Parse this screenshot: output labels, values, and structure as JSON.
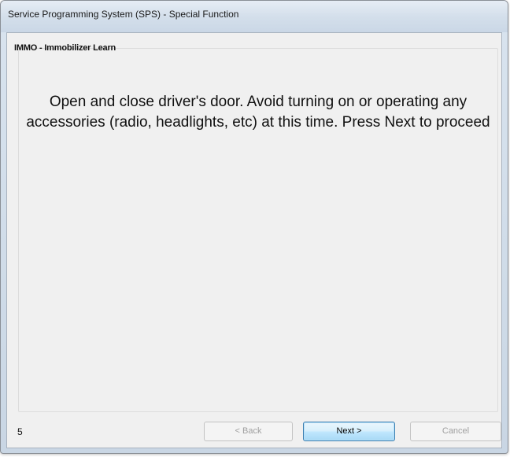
{
  "window": {
    "title": "Service Programming System (SPS) - Special Function"
  },
  "wizard": {
    "header": "IMMO - Immobilizer Learn",
    "instruction": "Open and close driver's door. Avoid turning on or operating any accessories (radio, headlights, etc) at this time. Press Next to proceed",
    "step_number": "5"
  },
  "buttons": {
    "back_label": "< Back",
    "back_enabled": false,
    "next_label": "Next >",
    "next_enabled": true,
    "cancel_label": "Cancel",
    "cancel_enabled": false
  },
  "colors": {
    "titlebar": "#d4dfeb",
    "client_background": "#f0f0f0",
    "default_button_border": "#3c7fb1",
    "disabled_text": "#a0a0a0"
  }
}
